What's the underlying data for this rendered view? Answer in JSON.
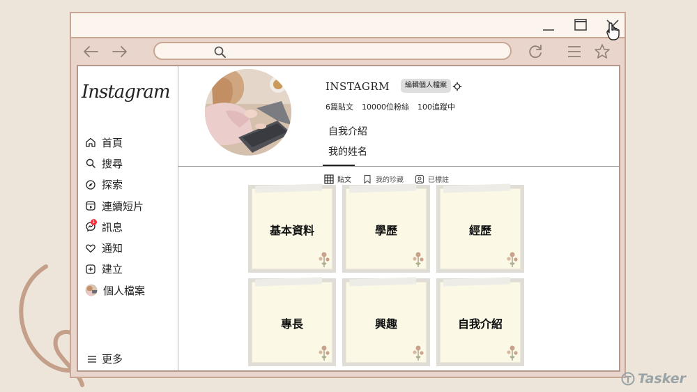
{
  "browser": {
    "url_value": ""
  },
  "sidebar": {
    "logo": "Instagram",
    "items": [
      {
        "label": "首頁",
        "icon": "home-icon"
      },
      {
        "label": "搜尋",
        "icon": "search-icon"
      },
      {
        "label": "探索",
        "icon": "compass-icon"
      },
      {
        "label": "連續短片",
        "icon": "reels-icon"
      },
      {
        "label": "訊息",
        "icon": "messenger-icon"
      },
      {
        "label": "通知",
        "icon": "heart-icon"
      },
      {
        "label": "建立",
        "icon": "plus-square-icon"
      },
      {
        "label": "個人檔案",
        "icon": "avatar-icon"
      }
    ],
    "more_label": "更多",
    "notification_badge": "1"
  },
  "profile": {
    "username": "INSTAGRM",
    "edit_label": "編輯個人檔案",
    "stats": {
      "posts": "6篇貼文",
      "followers": "10000位粉絲",
      "following": "100追蹤中"
    },
    "bio_line1": "自我介紹",
    "bio_line2": "我的姓名"
  },
  "tabs": [
    {
      "label": "貼文",
      "icon": "grid-icon",
      "active": true
    },
    {
      "label": "我的珍藏",
      "icon": "bookmark-icon",
      "active": false
    },
    {
      "label": "已標註",
      "icon": "tagged-icon",
      "active": false
    }
  ],
  "posts": [
    {
      "label": "基本資料"
    },
    {
      "label": "學歷"
    },
    {
      "label": "經歷"
    },
    {
      "label": "專長"
    },
    {
      "label": "興趣"
    },
    {
      "label": "自我介紹"
    }
  ],
  "watermark": "Tasker",
  "colors": {
    "background": "#ede4da",
    "window_frame": "#c9a694",
    "window_fill": "#e9d5cb",
    "titlebar": "#fbf5ee",
    "paper": "#fbf9e6",
    "decor_stroke": "#c4a08b"
  }
}
